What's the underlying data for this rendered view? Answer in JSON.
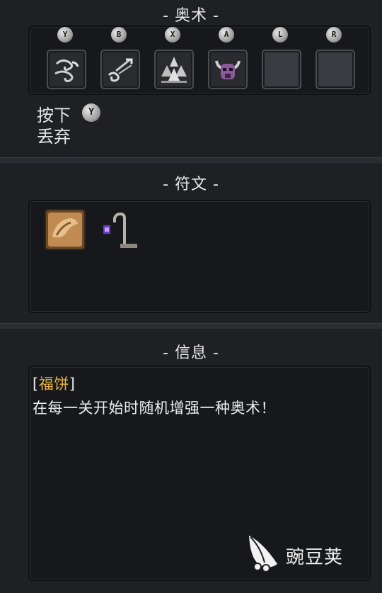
{
  "arcana": {
    "title": "- 奥术 -",
    "slots": [
      {
        "button": "Y",
        "icon": "wind-swirl-icon"
      },
      {
        "button": "B",
        "icon": "dash-wind-icon"
      },
      {
        "button": "X",
        "icon": "earth-spike-icon"
      },
      {
        "button": "A",
        "icon": "horned-helmet-icon"
      },
      {
        "button": "L",
        "icon": "empty-slot"
      },
      {
        "button": "R",
        "icon": "empty-slot"
      }
    ],
    "drop_hint": {
      "line1": "按下",
      "button": "Y",
      "line2": "丢弃"
    }
  },
  "relics": {
    "title": "- 符文 -",
    "items": [
      {
        "icon": "fortune-cookie-icon"
      },
      {
        "icon": "staff-lantern-icon"
      }
    ]
  },
  "info": {
    "title": "- 信息 -",
    "bracket_open": "[",
    "name": "福饼",
    "bracket_close": "]",
    "description": "在每一关开始时随机增强一种奥术！"
  },
  "watermark": {
    "text": "豌豆荚"
  },
  "colors": {
    "background": "#1f2023",
    "panel": "#17181b",
    "highlight_name": "#e9b33e",
    "text": "#e6e6e6"
  }
}
